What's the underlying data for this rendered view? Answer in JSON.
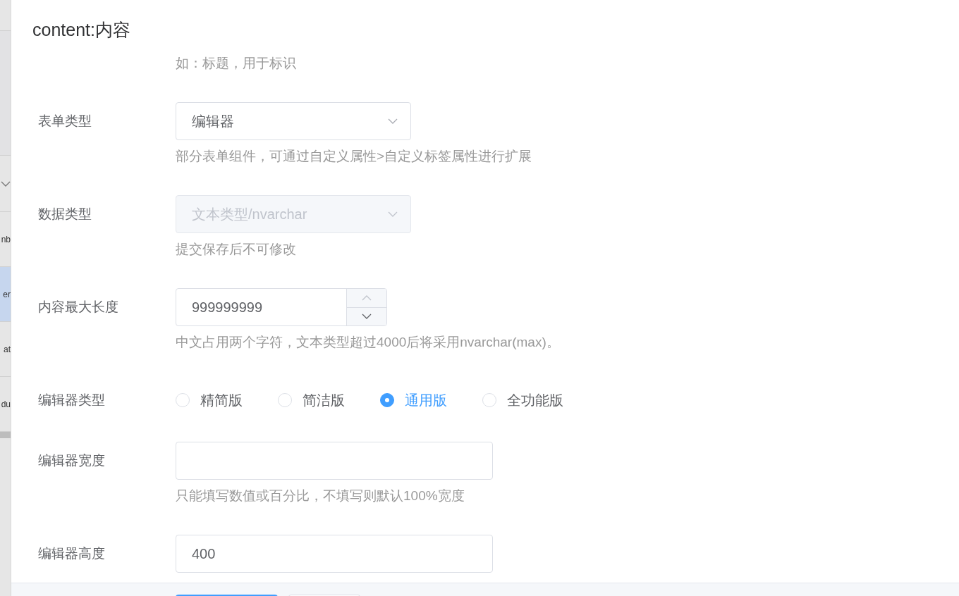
{
  "background_list": {
    "items": [
      {
        "selected": false
      },
      {
        "kind": "toggle",
        "selected": false
      },
      {
        "text": "nb",
        "selected": false
      },
      {
        "text": "er",
        "selected": true
      },
      {
        "text": "at",
        "selected": false
      },
      {
        "text": "du",
        "selected": false
      }
    ]
  },
  "drawer": {
    "title": "content:内容",
    "top_hint": "如：标题，用于标识",
    "fields": [
      {
        "kind": "select",
        "label": "表单类型",
        "value": "编辑器",
        "disabled": false,
        "hint": "部分表单组件，可通过自定义属性>自定义标签属性进行扩展"
      },
      {
        "kind": "select",
        "label": "数据类型",
        "value": "文本类型/nvarchar",
        "disabled": true,
        "hint": "提交保存后不可修改"
      },
      {
        "kind": "number",
        "label": "内容最大长度",
        "value": "999999999",
        "hint": "中文占用两个字符，文本类型超过4000后将采用nvarchar(max)。"
      },
      {
        "kind": "radio",
        "label": "编辑器类型",
        "options": [
          {
            "label": "精简版",
            "selected": false
          },
          {
            "label": "简洁版",
            "selected": false
          },
          {
            "label": "通用版",
            "selected": true
          },
          {
            "label": "全功能版",
            "selected": false
          }
        ]
      },
      {
        "kind": "input",
        "label": "编辑器宽度",
        "hint": "只能填写数值或百分比，不填写则默认100%宽度"
      },
      {
        "kind": "input",
        "label": "编辑器高度",
        "value": "400"
      }
    ]
  }
}
